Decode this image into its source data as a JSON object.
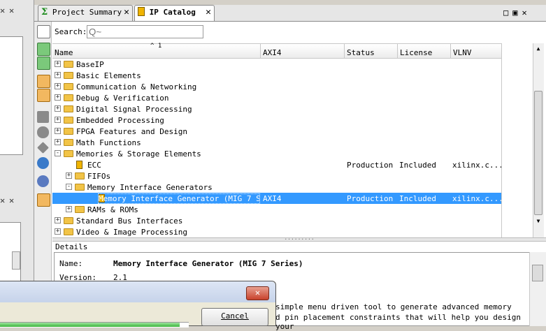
{
  "tabs": [
    {
      "label": "Project Summary",
      "active": false
    },
    {
      "label": "IP Catalog",
      "active": true
    }
  ],
  "search": {
    "label": "Search:",
    "placeholder": "Q~"
  },
  "columns": [
    "Name",
    "AXI4",
    "Status",
    "License",
    "VLNV"
  ],
  "sort_indicator": "^ 1",
  "rows": [
    {
      "name": "BaseIP",
      "level": 0,
      "expander": "+",
      "type": "folder",
      "axi4": "",
      "status": "",
      "license": "",
      "vlnv": ""
    },
    {
      "name": "Basic Elements",
      "level": 0,
      "expander": "+",
      "type": "folder",
      "axi4": "",
      "status": "",
      "license": "",
      "vlnv": ""
    },
    {
      "name": "Communication & Networking",
      "level": 0,
      "expander": "+",
      "type": "folder",
      "axi4": "",
      "status": "",
      "license": "",
      "vlnv": ""
    },
    {
      "name": "Debug & Verification",
      "level": 0,
      "expander": "+",
      "type": "folder",
      "axi4": "",
      "status": "",
      "license": "",
      "vlnv": ""
    },
    {
      "name": "Digital Signal Processing",
      "level": 0,
      "expander": "+",
      "type": "folder",
      "axi4": "",
      "status": "",
      "license": "",
      "vlnv": ""
    },
    {
      "name": "Embedded Processing",
      "level": 0,
      "expander": "+",
      "type": "folder",
      "axi4": "",
      "status": "",
      "license": "",
      "vlnv": ""
    },
    {
      "name": "FPGA Features and Design",
      "level": 0,
      "expander": "+",
      "type": "folder",
      "axi4": "",
      "status": "",
      "license": "",
      "vlnv": ""
    },
    {
      "name": "Math Functions",
      "level": 0,
      "expander": "+",
      "type": "folder",
      "axi4": "",
      "status": "",
      "license": "",
      "vlnv": ""
    },
    {
      "name": "Memories & Storage Elements",
      "level": 0,
      "expander": "-",
      "type": "folder",
      "axi4": "",
      "status": "",
      "license": "",
      "vlnv": ""
    },
    {
      "name": "ECC",
      "level": 1,
      "expander": "",
      "type": "ip",
      "axi4": "",
      "status": "Production",
      "license": "Included",
      "vlnv": "xilinx.c..."
    },
    {
      "name": "FIFOs",
      "level": 1,
      "expander": "+",
      "type": "folder",
      "axi4": "",
      "status": "",
      "license": "",
      "vlnv": ""
    },
    {
      "name": "Memory Interface Generators",
      "level": 1,
      "expander": "-",
      "type": "folder",
      "axi4": "",
      "status": "",
      "license": "",
      "vlnv": ""
    },
    {
      "name": "Memory Interface Generator (MIG 7 S...",
      "level": 2,
      "expander": "",
      "type": "ip",
      "axi4": "AXI4",
      "status": "Production",
      "license": "Included",
      "vlnv": "xilinx.c...",
      "selected": true
    },
    {
      "name": "RAMs & ROMs",
      "level": 1,
      "expander": "+",
      "type": "folder",
      "axi4": "",
      "status": "",
      "license": "",
      "vlnv": ""
    },
    {
      "name": "Standard Bus Interfaces",
      "level": 0,
      "expander": "+",
      "type": "folder",
      "axi4": "",
      "status": "",
      "license": "",
      "vlnv": ""
    },
    {
      "name": "Video & Image Processing",
      "level": 0,
      "expander": "+",
      "type": "folder",
      "axi4": "",
      "status": "",
      "license": "",
      "vlnv": ""
    }
  ],
  "details": {
    "title": "Details",
    "name_label": "Name:",
    "name_value": "Memory Interface Generator (MIG 7 Series)",
    "version_label": "Version:",
    "version_value": "2.1",
    "desc_line1": "simple menu driven tool to generate advanced memory",
    "desc_line2": "d pin placement constraints that will help you design your"
  },
  "left_panel": {
    "close1": "✕",
    "close2": "✕"
  },
  "dialog": {
    "close": "✕",
    "cancel_label": "Cancel",
    "progress_fraction": 0.95
  },
  "colors": {
    "selection": "#3399ff",
    "folder": "#f2c447",
    "ip_icon": "#f0b400"
  }
}
